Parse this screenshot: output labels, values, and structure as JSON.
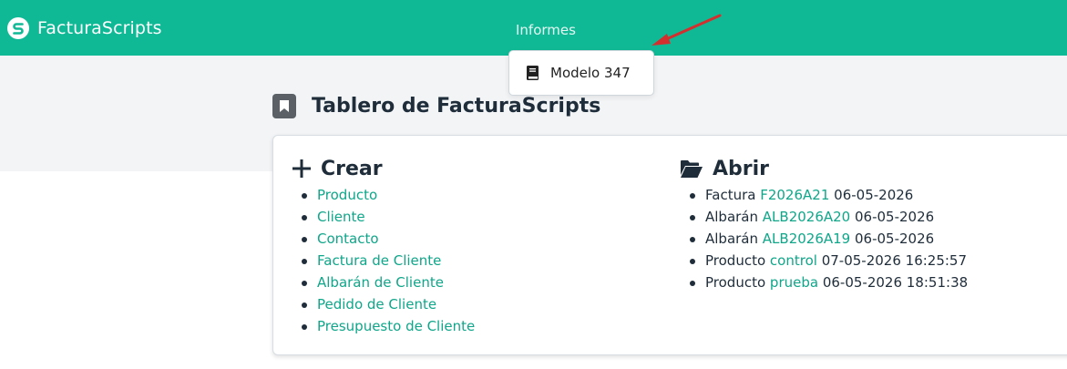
{
  "navbar": {
    "brand": "FacturaScripts",
    "menu_informes": "Informes"
  },
  "dropdown": {
    "items": [
      {
        "label": "Modelo 347",
        "icon": "book-icon"
      }
    ]
  },
  "page": {
    "title": "Tablero de FacturaScripts"
  },
  "create": {
    "heading": "Crear",
    "items": [
      "Producto",
      "Cliente",
      "Contacto",
      "Factura de Cliente",
      "Albarán de Cliente",
      "Pedido de Cliente",
      "Presupuesto de Cliente"
    ]
  },
  "open": {
    "heading": "Abrir",
    "items": [
      {
        "type": "Factura",
        "code": "F2026A21",
        "date": "06-05-2026"
      },
      {
        "type": "Albarán",
        "code": "ALB2026A20",
        "date": "06-05-2026"
      },
      {
        "type": "Albarán",
        "code": "ALB2026A19",
        "date": "06-05-2026"
      },
      {
        "type": "Producto",
        "code": "control",
        "date": "07-05-2026 16:25:57"
      },
      {
        "type": "Producto",
        "code": "prueba",
        "date": "06-05-2026 18:51:38"
      }
    ]
  },
  "colors": {
    "navbar": "#10b995",
    "link": "#0fa68a",
    "annotation_arrow": "#d32f2f"
  }
}
